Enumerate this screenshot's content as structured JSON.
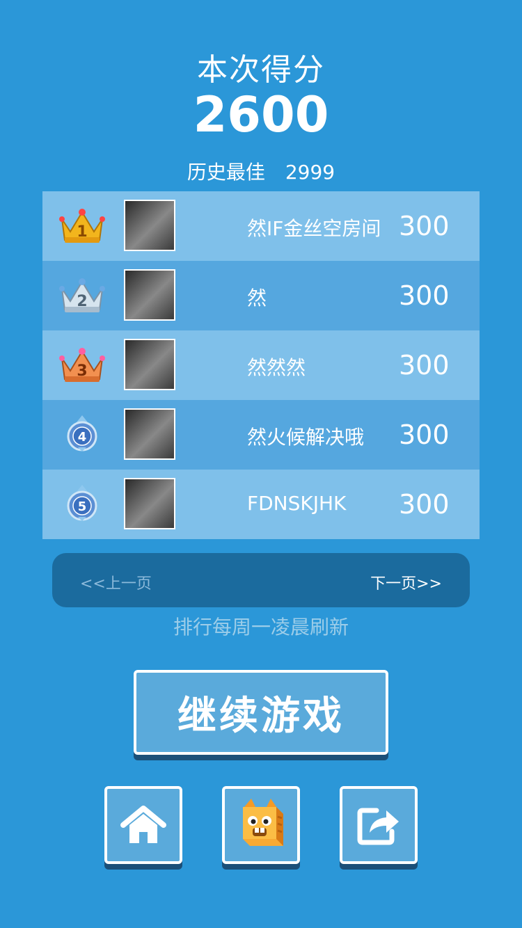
{
  "score": {
    "title": "本次得分",
    "value": "2600"
  },
  "best": {
    "label": "历史最佳",
    "value": "2999"
  },
  "leaderboard": [
    {
      "rank": 1,
      "rank_icon": "gold-crown-icon",
      "name": "然IF金丝空房间",
      "score": "300"
    },
    {
      "rank": 2,
      "rank_icon": "silver-crown-icon",
      "name": "然",
      "score": "300"
    },
    {
      "rank": 3,
      "rank_icon": "bronze-crown-icon",
      "name": "然然然",
      "score": "300"
    },
    {
      "rank": 4,
      "rank_icon": "blue-medal-icon",
      "name": "然火候解决哦",
      "score": "300"
    },
    {
      "rank": 5,
      "rank_icon": "blue-medal-icon",
      "name": "FDNSKJHK",
      "score": "300"
    }
  ],
  "pager": {
    "prev": "<<上一页",
    "next": "下一页>>"
  },
  "refresh_note": "排行每周一凌晨刷新",
  "continue_label": "继续游戏",
  "icons": {
    "home": "home-icon",
    "character": "character-icon",
    "share": "share-icon"
  },
  "colors": {
    "background": "#2b97d8",
    "row_light": "#7fc0ea",
    "row_dark": "#55a7df",
    "pager_bg": "#1b6b9e",
    "button_fill": "#5aaadb"
  }
}
